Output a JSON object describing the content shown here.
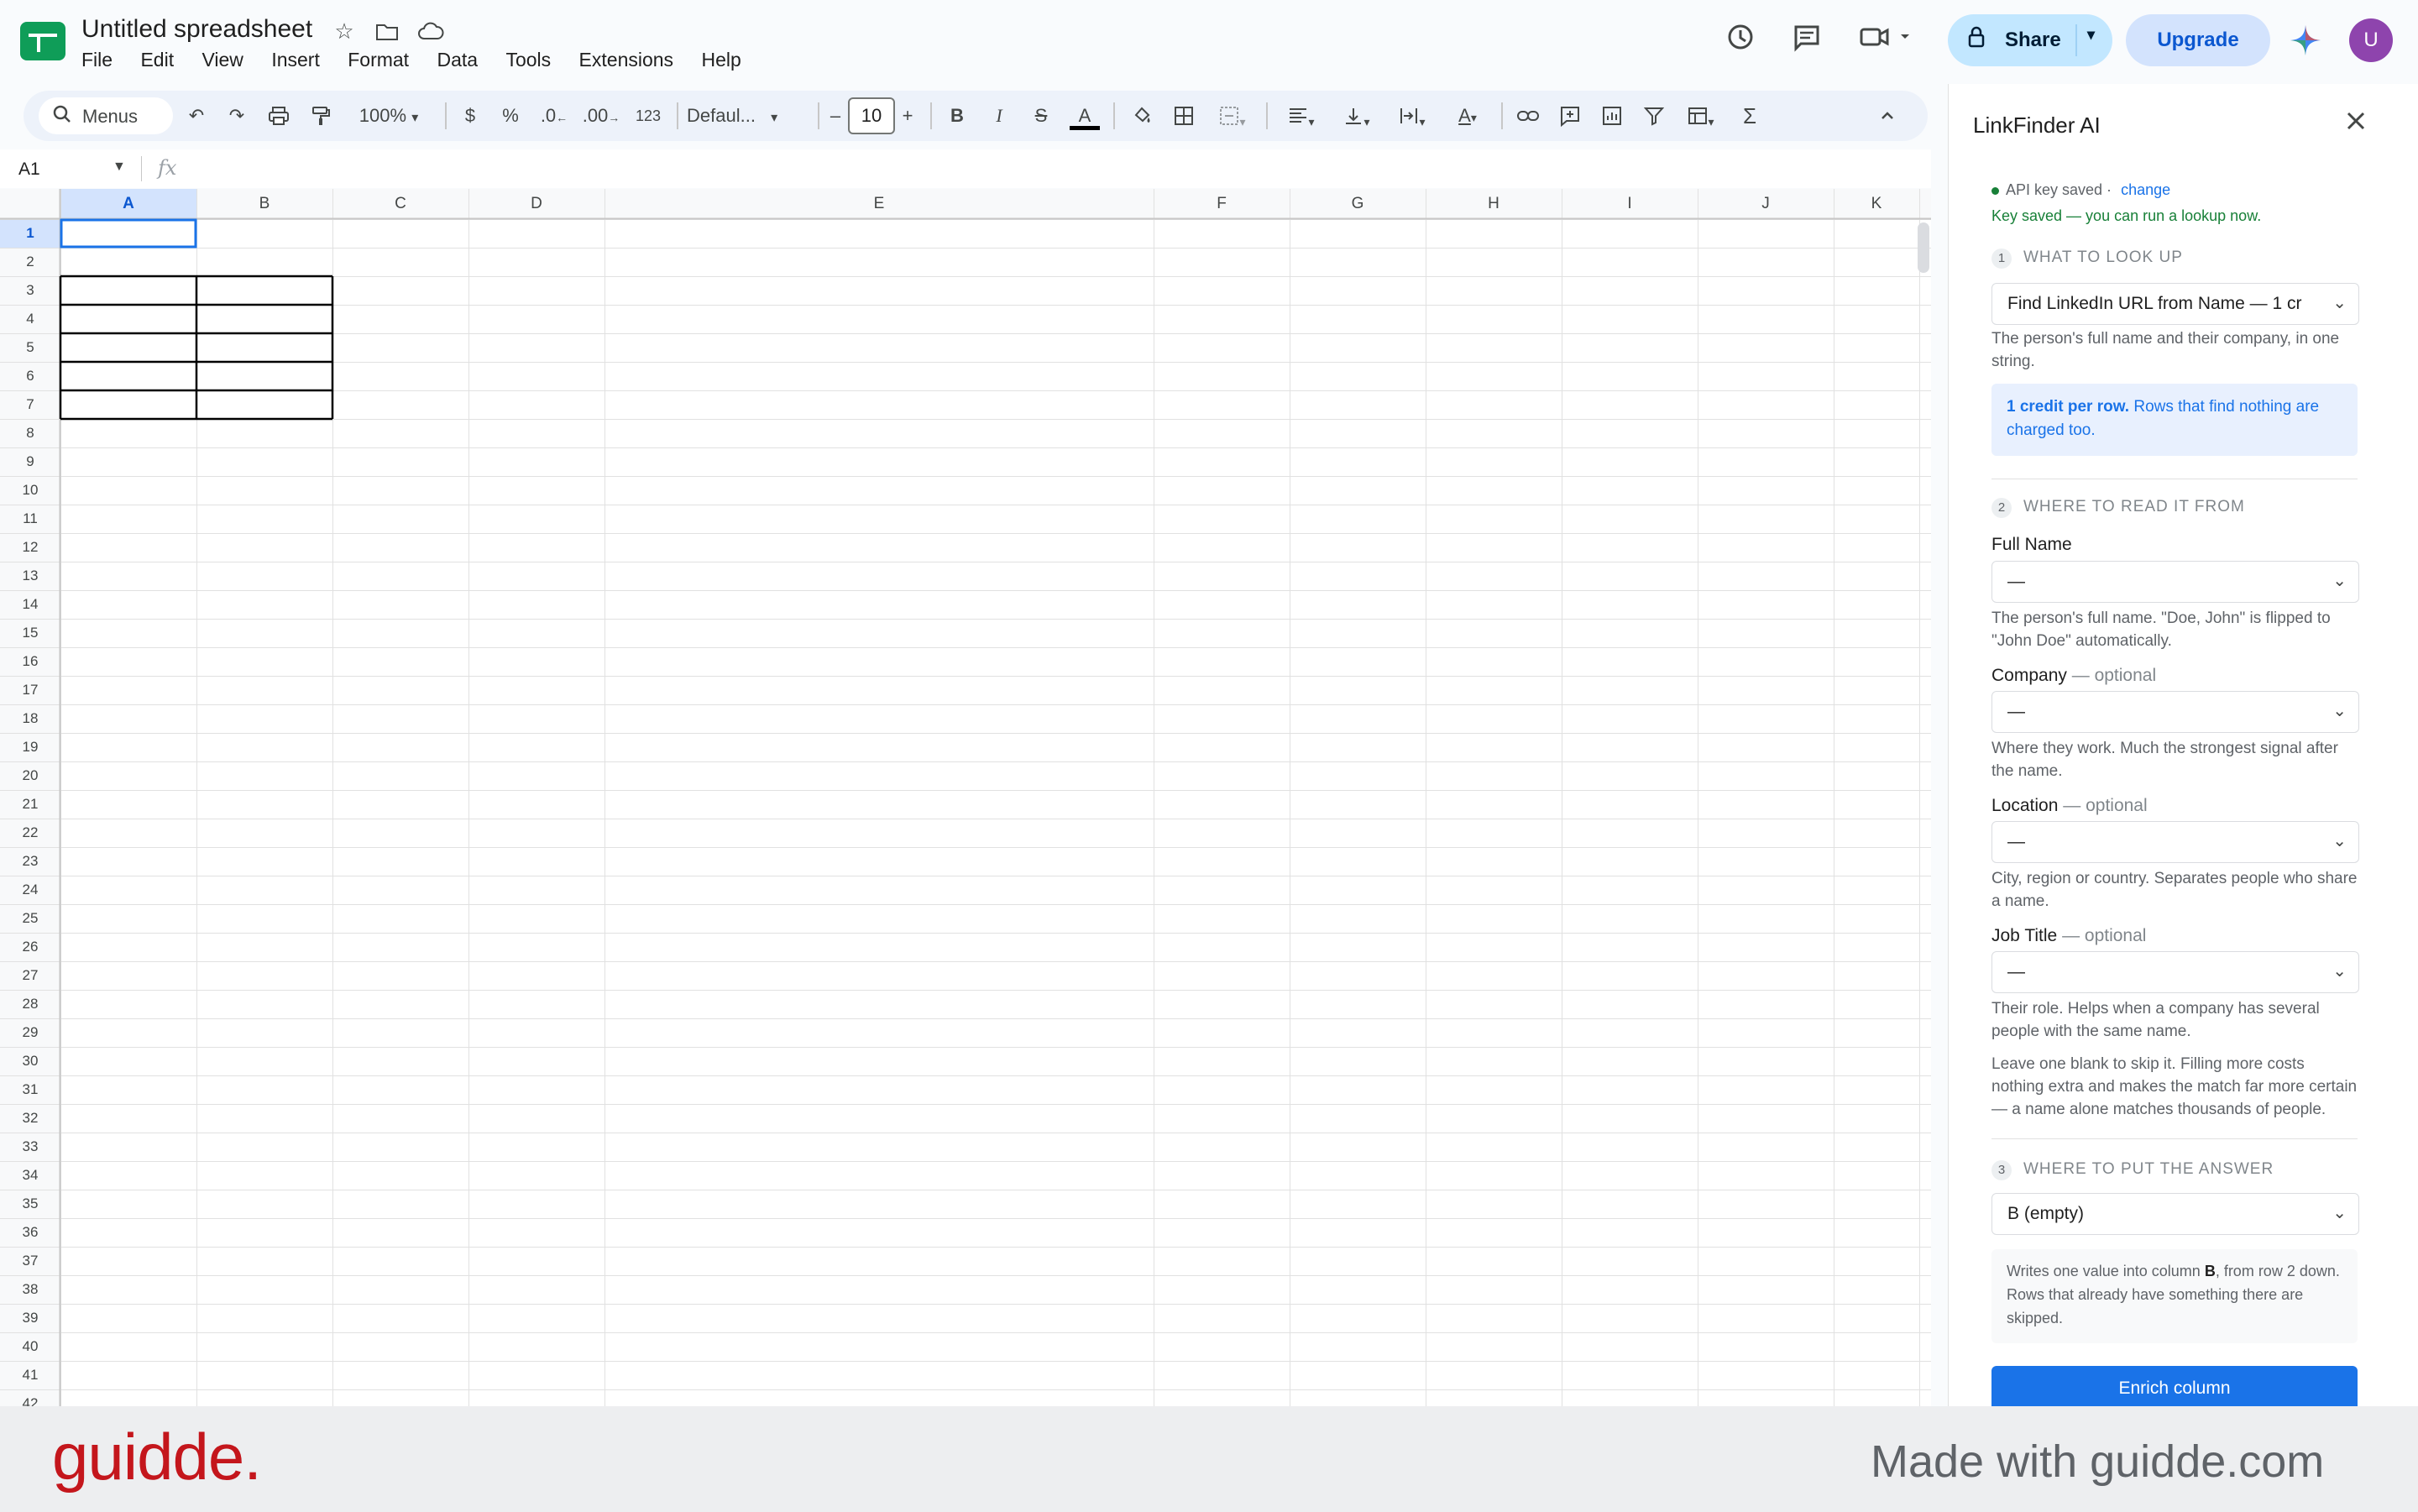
{
  "header": {
    "doc_title": "Untitled spreadsheet",
    "menu": [
      "File",
      "Edit",
      "View",
      "Insert",
      "Format",
      "Data",
      "Tools",
      "Extensions",
      "Help"
    ],
    "share_label": "Share",
    "upgrade_label": "Upgrade",
    "avatar_initial": "U"
  },
  "toolbar": {
    "menus_label": "Menus",
    "zoom": "100%",
    "currency": "$",
    "percent": "%",
    "dec_decrease": ".0",
    "dec_increase": ".00",
    "number_format": "123",
    "font": "Defaul...",
    "font_size": "10",
    "bold": "B",
    "italic": "I",
    "sum": "Σ"
  },
  "formula_bar": {
    "cell_ref": "A1",
    "fx": "fx"
  },
  "grid": {
    "columns": [
      "A",
      "B",
      "C",
      "D",
      "E",
      "F",
      "G",
      "H",
      "I",
      "J",
      "K"
    ],
    "rows": [
      "1",
      "2",
      "3",
      "4",
      "5",
      "6",
      "7",
      "8",
      "9",
      "10",
      "11",
      "12",
      "13",
      "14",
      "15",
      "16",
      "17",
      "18",
      "19",
      "20",
      "21",
      "22",
      "23",
      "24",
      "25",
      "26",
      "27",
      "28",
      "29",
      "30",
      "31",
      "32",
      "33",
      "34",
      "35",
      "36",
      "37",
      "38",
      "39",
      "40",
      "41",
      "42"
    ],
    "selected_cell": "A1"
  },
  "panel": {
    "title": "LinkFinder AI",
    "api_status": "API key saved ·",
    "api_change": "change",
    "api_ready": "Key saved — you can run a lookup now.",
    "section1": {
      "num": "1",
      "title": "WHAT TO LOOK UP",
      "select_value": "Find LinkedIn URL from Name — 1 cr",
      "help": "The person's full name and their company, in one string.",
      "note_bold": "1 credit per row.",
      "note_text": "Rows that find nothing are charged too."
    },
    "section2": {
      "num": "2",
      "title": "WHERE TO READ IT FROM",
      "fields": [
        {
          "label": "Full Name",
          "optional": "",
          "value": "—",
          "help": "The person's full name. \"Doe, John\" is flipped to \"John Doe\" automatically."
        },
        {
          "label": "Company",
          "optional": "— optional",
          "value": "—",
          "help": "Where they work. Much the strongest signal after the name."
        },
        {
          "label": "Location",
          "optional": "— optional",
          "value": "—",
          "help": "City, region or country. Separates people who share a name."
        },
        {
          "label": "Job Title",
          "optional": "— optional",
          "value": "—",
          "help": "Their role. Helps when a company has several people with the same name."
        }
      ],
      "footnote": "Leave one blank to skip it. Filling more costs nothing extra and makes the match far more certain — a name alone matches thousands of people."
    },
    "section3": {
      "num": "3",
      "title": "WHERE TO PUT THE ANSWER",
      "select_value": "B (empty)",
      "note_pre": "Writes one value into column",
      "note_col": "B",
      "note_post": ", from row 2 down. Rows that already have something there are skipped."
    },
    "enrich_label": "Enrich column"
  },
  "footer": {
    "logo_text": "guidde.",
    "made_with": "Made with guidde.com"
  }
}
